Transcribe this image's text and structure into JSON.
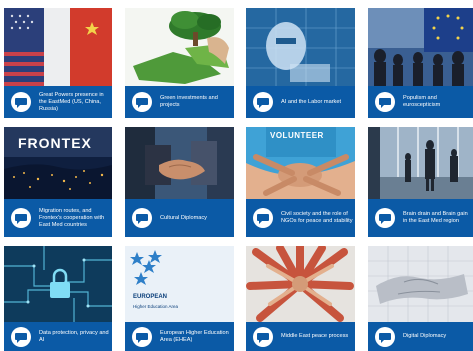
{
  "tiles": [
    {
      "caption": "Great Powers presence in the EastMed (US, China, Russia)",
      "image": "us-china-russia-flags-image"
    },
    {
      "caption": "Green investments and projects",
      "image": "green-puzzle-image"
    },
    {
      "caption": "AI and the Labor market",
      "image": "robot-ai-image"
    },
    {
      "caption": "Populism and euroscepticism",
      "image": "crowd-eu-flag-image"
    },
    {
      "caption": "Migration routes, and Frontex's cooperation with East Med countries",
      "image": "frontex-image",
      "overlay": "FRONTEX"
    },
    {
      "caption": "Cultural Diplomacy",
      "image": "handshake-image"
    },
    {
      "caption": "Civil society and the role of NGOs for peace and stability",
      "image": "volunteer-hands-image",
      "overlay": "VOLUNTEER"
    },
    {
      "caption": "Brain drain and Brain gain in the East Med region",
      "image": "airport-travellers-image"
    },
    {
      "caption": "Data protection, privacy and AI",
      "image": "circuit-lock-image"
    },
    {
      "caption": "European Higher Education Area (EHEA)",
      "image": "ehea-logo-image",
      "overlay": "EUROPEAN",
      "overlay_sub": "Higher Education Area"
    },
    {
      "caption": "Middle East peace process",
      "image": "hands-circle-image"
    },
    {
      "caption": "Digital Diplomacy",
      "image": "digital-handshake-image"
    }
  ],
  "icon": "speech-bubble-icon",
  "colors": {
    "bar": "#0b5aa6",
    "caption_text": "#ffffff"
  }
}
